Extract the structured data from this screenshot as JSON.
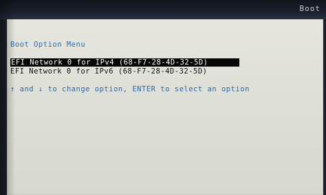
{
  "window": {
    "title": "Boot"
  },
  "menu": {
    "title": "Boot Option Menu",
    "options": [
      {
        "label": "EFI Network 0 for IPv4 (68-F7-28-4D-32-5D)",
        "selected": true
      },
      {
        "label": "EFI Network 0 for IPv6 (68-F7-28-4D-32-5D)",
        "selected": false
      }
    ],
    "instructions": "↑ and ↓ to change option, ENTER to select an option"
  },
  "colors": {
    "accent": "#2e6da6",
    "selected_bg": "#060708",
    "panel_bg": "#dedfd7",
    "top_bg": "#1c2028"
  }
}
